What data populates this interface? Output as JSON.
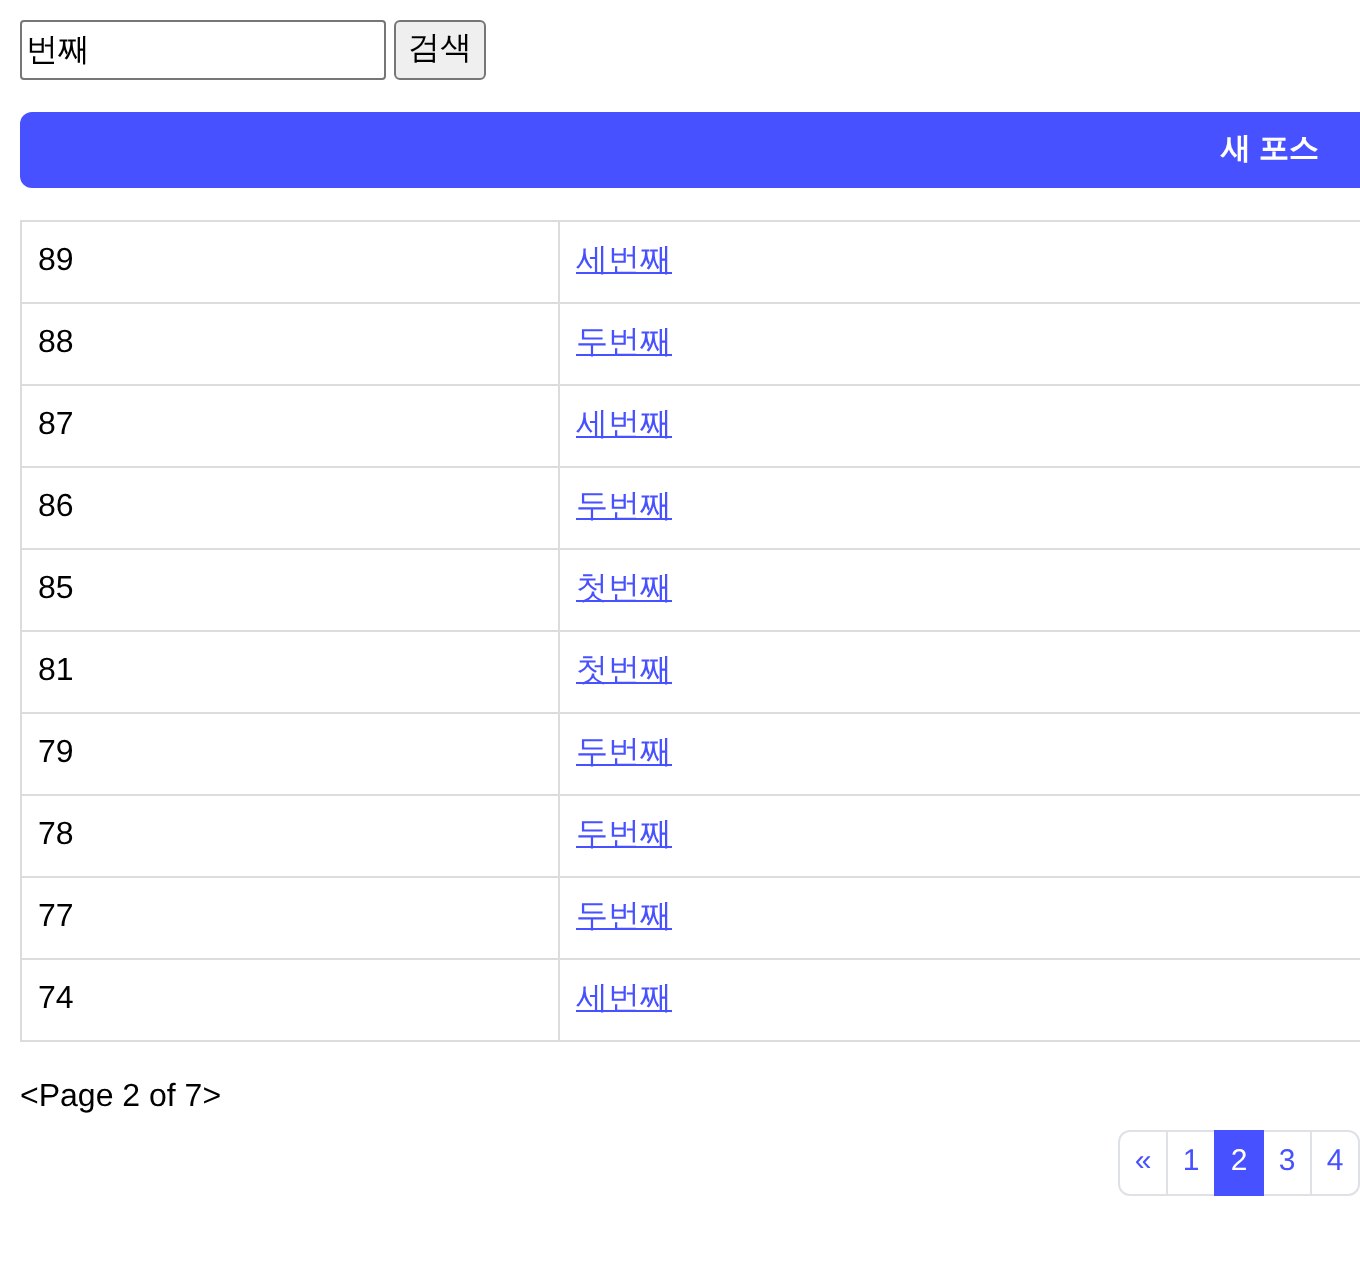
{
  "search": {
    "value": "번째",
    "button": "검색"
  },
  "new_post_button": "새 포스",
  "table": {
    "rows": [
      {
        "id": "89",
        "title": "세번째"
      },
      {
        "id": "88",
        "title": "두번째"
      },
      {
        "id": "87",
        "title": "세번째"
      },
      {
        "id": "86",
        "title": "두번째"
      },
      {
        "id": "85",
        "title": "첫번째"
      },
      {
        "id": "81",
        "title": "첫번째"
      },
      {
        "id": "79",
        "title": "두번째"
      },
      {
        "id": "78",
        "title": "두번째"
      },
      {
        "id": "77",
        "title": "두번째"
      },
      {
        "id": "74",
        "title": "세번째"
      }
    ]
  },
  "page_info": "<Page 2 of 7>",
  "pagination": [
    {
      "label": "«",
      "selected": false
    },
    {
      "label": "1",
      "selected": false
    },
    {
      "label": "2",
      "selected": true
    },
    {
      "label": "3",
      "selected": false
    },
    {
      "label": "4",
      "selected": false
    }
  ]
}
